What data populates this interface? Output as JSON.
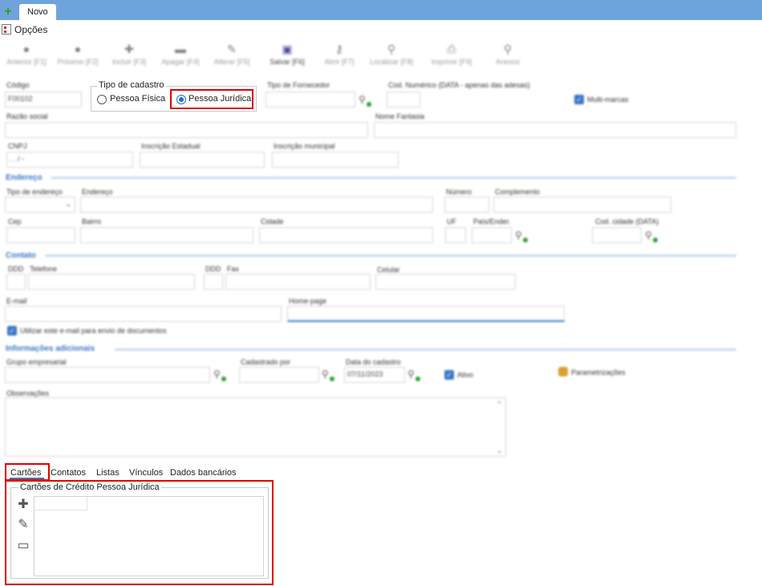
{
  "window": {
    "tab_label": "Novo",
    "menu_label": "Opções"
  },
  "toolbar": [
    {
      "label": "Anterior [F1]",
      "icon": "circle-left-icon",
      "glyph": "●"
    },
    {
      "label": "Próximo [F2]",
      "icon": "circle-right-icon",
      "glyph": "●"
    },
    {
      "label": "Incluir [F3]",
      "icon": "plus-icon",
      "glyph": "✚"
    },
    {
      "label": "Apagar [F4]",
      "icon": "minus-icon",
      "glyph": "▬"
    },
    {
      "label": "Alterar [F5]",
      "icon": "edit-icon",
      "glyph": "✎"
    },
    {
      "label": "Salvar [F6]",
      "icon": "save-icon",
      "glyph": "▣"
    },
    {
      "label": "Abrir [F7]",
      "icon": "key-icon",
      "glyph": "⚷"
    },
    {
      "label": "Localizar [F8]",
      "icon": "search-icon",
      "glyph": "⚲"
    },
    {
      "label": "Imprimir [F9]",
      "icon": "print-icon",
      "glyph": "⎙"
    },
    {
      "label": "Anexos",
      "icon": "paperclip-icon",
      "glyph": "⚲"
    }
  ],
  "form": {
    "codigo_label": "Código",
    "codigo_value": "F00102",
    "tipo_cadastro_label": "Tipo de cadastro",
    "pessoa_fisica": "Pessoa Física",
    "pessoa_juridica": "Pessoa Jurídica",
    "tipo_fornecedor_label": "Tipo de Fornecedor",
    "cod_numerico_label": "Cod. Numérico (DATA - apenas das adesas)",
    "multi_marcas_label": "Multi-marcas",
    "razao_social_label": "Razão social",
    "nome_fantasia_label": "Nome Fantasia",
    "cnpj_label": "CNPJ",
    "cnpj_mask": " .  .  /   -",
    "inscricao_estadual_label": "Inscrição Estadual",
    "inscricao_municipal_label": "Inscrição municipal"
  },
  "endereco": {
    "section": "Endereço",
    "tipo_label": "Tipo de endereço",
    "endereco_label": "Endereço",
    "numero_label": "Número",
    "complemento_label": "Complemento",
    "cep_label": "Cep",
    "bairro_label": "Bairro",
    "cidade_label": "Cidade",
    "uf_label": "UF",
    "pais_label": "País/Ender.",
    "cod_cidade_label": "Cod. cidade (DATA)"
  },
  "contato": {
    "section": "Contato",
    "ddd_label": "DDD",
    "telefone_label": "Telefone",
    "ddd2_label": "DDD",
    "fax_label": "Fax",
    "celular_label": "Celular",
    "email_label": "E-mail",
    "homepage_label": "Home-page",
    "usar_email_label": "Utilizar este e-mail para envio de documentos"
  },
  "adicionais": {
    "section": "Informações adicionais",
    "grupo_label": "Grupo empresarial",
    "cadastrado_por_label": "Cadastrado por",
    "data_cadastro_label": "Data do cadastro",
    "data_cadastro_value": "07/11/2023",
    "ativo_label": "Ativo",
    "parametrizacoes_label": "Parametrizações",
    "observacoes_label": "Observações"
  },
  "tabs": [
    "Cartões",
    "Contatos",
    "Listas",
    "Vínculos",
    "Dados bancários"
  ],
  "cartoes": {
    "group_label": "Cartões de Crédito Pessoa Jurídica"
  },
  "colors": {
    "titlebar": "#6fa3dc",
    "accent": "#3a77c5",
    "highlight": "#e00000"
  }
}
